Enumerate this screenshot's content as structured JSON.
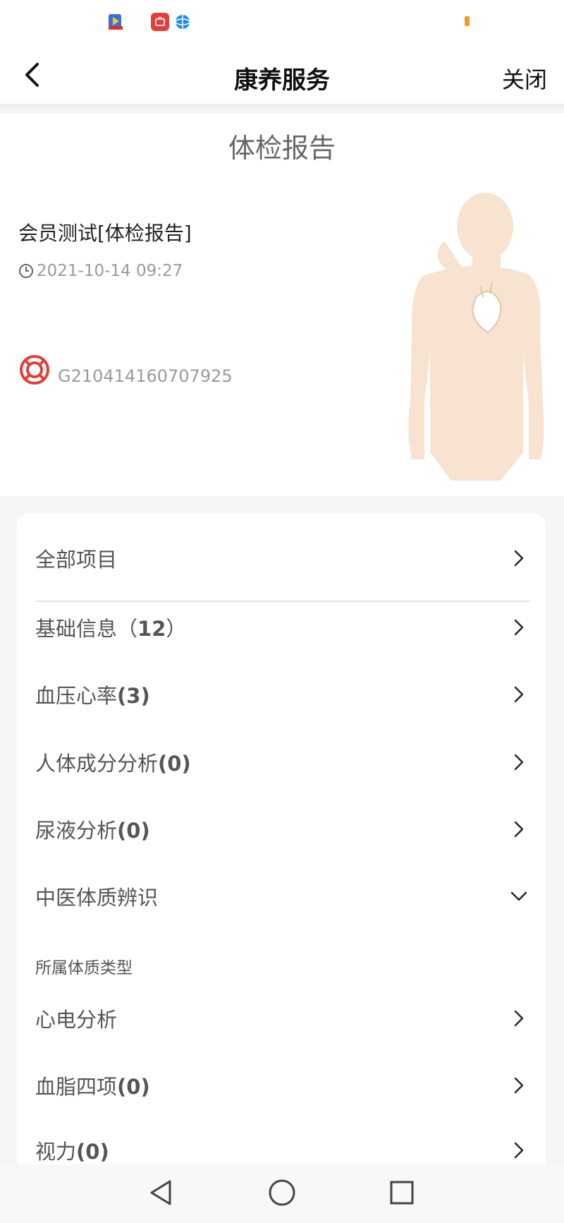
{
  "status_bar": {
    "icons": [
      "video-app-icon",
      "huawei-app-icon",
      "browser-app-icon"
    ],
    "battery_color": "#f29b2c"
  },
  "nav": {
    "title": "康养服务",
    "close_label": "关闭"
  },
  "report": {
    "title": "体检报告",
    "member_name": "会员测试[体检报告]",
    "time": "2021-10-14 09:27",
    "code": "G210414160707925",
    "accent_color": "#e0403a"
  },
  "items": [
    {
      "label": "全部项目",
      "count": "",
      "icon": "chevron-right-icon"
    },
    {
      "label": "基础信息（",
      "count": "12",
      "suffix": "）",
      "icon": "chevron-right-icon"
    },
    {
      "label": "血压心率",
      "count": "(3)",
      "icon": "chevron-right-icon"
    },
    {
      "label": "人体成分分析",
      "count": "(0)",
      "icon": "chevron-right-icon"
    },
    {
      "label": "尿液分析",
      "count": "(0)",
      "icon": "chevron-right-icon"
    },
    {
      "label": "中医体质辨识",
      "count": "",
      "icon": "chevron-down-icon"
    },
    {
      "label": "心电分析",
      "count": "",
      "icon": "chevron-right-icon"
    },
    {
      "label": "血脂四项",
      "count": "(0)",
      "icon": "chevron-right-icon"
    },
    {
      "label": "视力",
      "count": "(0)",
      "icon": "chevron-right-icon"
    }
  ],
  "tcm_subtype_label": "所属体质类型"
}
